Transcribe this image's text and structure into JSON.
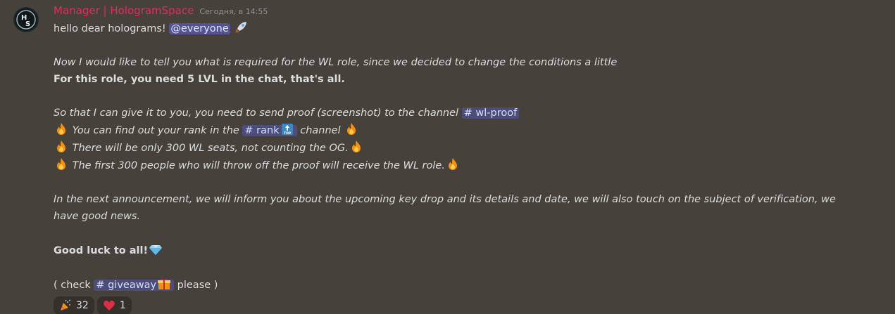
{
  "author": {
    "name": "Manager | HologramSpace",
    "avatar_text": "HS",
    "timestamp": "Сегодня, в 14:55"
  },
  "message": {
    "l1": "hello dear holograms!",
    "mention_everyone": "@everyone",
    "l3": "Now I would like to tell you what is required for the WL role, since we decided to change the conditions a little",
    "l4": "For this role, you need 5 LVL in the chat, that's all.",
    "l6": "So that I can give it to you, you need to send proof (screenshot) to the channel",
    "channel_wl_proof": "# wl-proof",
    "l7a": "You can find out your rank in the",
    "channel_rank": "# rank",
    "l7b": "channel",
    "l8": "There will be only 300 WL seats, not counting the OG.",
    "l9": "The first 300 people who will throw off the proof will receive the WL role.",
    "l11": "In the next announcement, we will inform you about the upcoming key drop and its details and date, we will also touch on the subject of verification, we have good news.",
    "l13": "Good luck to all!",
    "l15a": "( check",
    "channel_giveaway": "# giveaway",
    "l15b": "please )"
  },
  "emojis": {
    "rocket": "rocket-emoji",
    "fire": "fire-emoji",
    "top": "top-arrow-emoji",
    "gem": "gem-emoji",
    "gift": "gift-emoji",
    "party": "party-popper-emoji",
    "heart": "heart-emoji"
  },
  "reactions": [
    {
      "emoji": "party-popper-emoji",
      "count": "32"
    },
    {
      "emoji": "heart-emoji",
      "count": "1"
    }
  ],
  "colors": {
    "background": "#46423b",
    "username": "#e22b5b",
    "mention_bg": "#535392",
    "channel_bg": "#4b4d7a"
  }
}
